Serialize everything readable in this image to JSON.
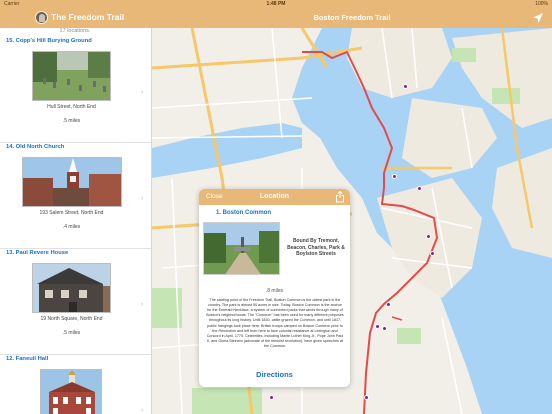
{
  "status_bar": {
    "carrier": "Carrier",
    "time": "1:48 PM",
    "battery": "100%"
  },
  "nav": {
    "app_title": "The Freedom Trail",
    "map_title": "Boston Freedom Trail"
  },
  "sidebar": {
    "count_text": "17 locations.",
    "items": [
      {
        "title": "15. Copp's Hill Burying Ground",
        "address": "Hull Street, North End",
        "distance": ".5 miles"
      },
      {
        "title": "14. Old North Church",
        "address": "193 Salem Street, North End",
        "distance": ".4 miles"
      },
      {
        "title": "13. Paul Revere House",
        "address": "19 North Square, North End",
        "distance": ".5 miles"
      },
      {
        "title": "12. Faneuil Hall",
        "address": "",
        "distance": ""
      }
    ]
  },
  "popover": {
    "close_label": "Close",
    "header_title": "Location",
    "name": "1. Boston Common",
    "bound_text": "Bound By Tremont, Beacon, Charles, Park & Boylston Streets",
    "distance": ".8 miles",
    "description": "The starting point of the Freedom Trail, Boston Common is the oldest park in the country. The park is almost 50 acres in size. Today, Boston Common is the anchor for the Emerald Necklace, a system of connected parks that winds through many of Boston's neighborhoods. The \"Common\" has been used for many different purposes throughout its long history. Until 1830, cattle grazed the Common, and until 1817, public hangings took place here. British troops camped on Boston Common prior to the Revolution and left from here to face colonial resistance at Lexington and Concord in April, 1775. Celebrities, including Martin Luther King Jr., Pope John Paul II, and Gloria Steinem (advocate of the feminist revolution), have given speeches at the Common.",
    "directions_label": "Directions"
  },
  "colors": {
    "accent": "#e7b877",
    "link": "#1b6fc9",
    "route": "#e34b4b",
    "pin": "#8a1f8c",
    "water": "#a9d3f5",
    "park": "#c5e6b4"
  },
  "icons": {
    "avatar": "app-avatar",
    "locate": "location-arrow-icon",
    "share": "share-icon",
    "chevron": "chevron-right-icon"
  }
}
